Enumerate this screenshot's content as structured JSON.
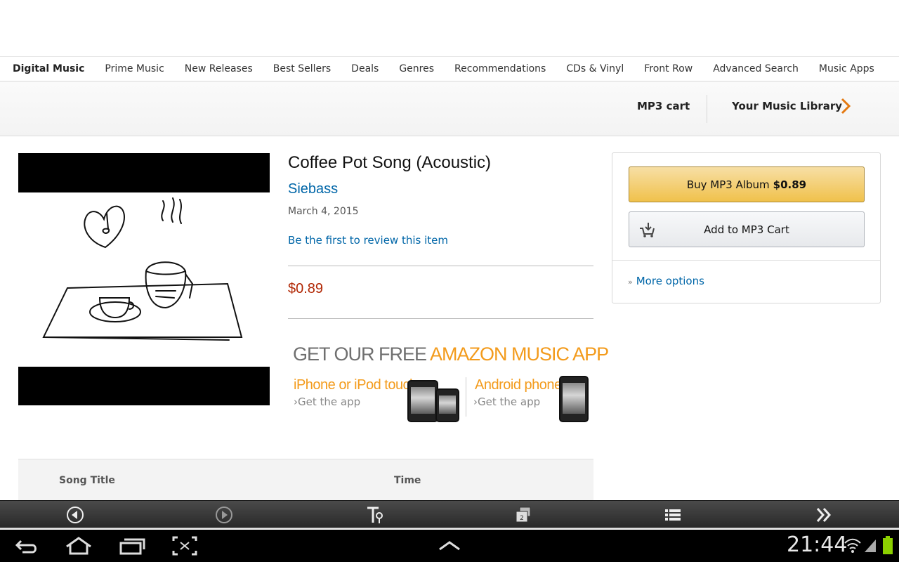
{
  "nav": {
    "items": [
      {
        "label": "Digital Music",
        "active": true
      },
      {
        "label": "Prime Music"
      },
      {
        "label": "New Releases"
      },
      {
        "label": "Best Sellers"
      },
      {
        "label": "Deals"
      },
      {
        "label": "Genres"
      },
      {
        "label": "Recommendations"
      },
      {
        "label": "CDs & Vinyl"
      },
      {
        "label": "Front Row"
      },
      {
        "label": "Advanced Search"
      },
      {
        "label": "Music Apps"
      }
    ]
  },
  "subbar": {
    "mp3_cart": "MP3 cart",
    "library": "Your Music Library"
  },
  "product": {
    "title": "Coffee Pot Song (Acoustic)",
    "artist": "Siebass",
    "release_date": "March 4, 2015",
    "review_link": "Be the first to review this item",
    "price": "$0.89"
  },
  "promo": {
    "headline_prefix": "GET OUR FREE ",
    "headline_highlight": "AMAZON MUSIC APP",
    "ios_label": "iPhone or iPod touch",
    "ios_link": "›Get the app",
    "android_label": "Android phone",
    "android_link": "›Get the app"
  },
  "buybox": {
    "buy_label": "Buy MP3 Album",
    "buy_price": "$0.89",
    "cart_label": "Add to MP3 Cart",
    "more_options": "More options"
  },
  "table": {
    "col_title": "Song Title",
    "col_time": "Time"
  },
  "toolbar": {
    "icons": [
      "back-circle-icon",
      "forward-circle-icon",
      "text-size-icon",
      "tabs-icon",
      "list-icon",
      "double-chevron-icon"
    ],
    "tab_count": "2"
  },
  "system": {
    "clock": "21:44",
    "icons": [
      "back-icon",
      "home-icon",
      "recent-apps-icon",
      "screenshot-icon",
      "up-arrow-icon",
      "wifi-icon",
      "signal-icon",
      "battery-icon"
    ]
  },
  "colors": {
    "link": "#0066a8",
    "price": "#b12704",
    "accent_orange": "#f39b1c",
    "buy_button": "#f0c14b"
  }
}
